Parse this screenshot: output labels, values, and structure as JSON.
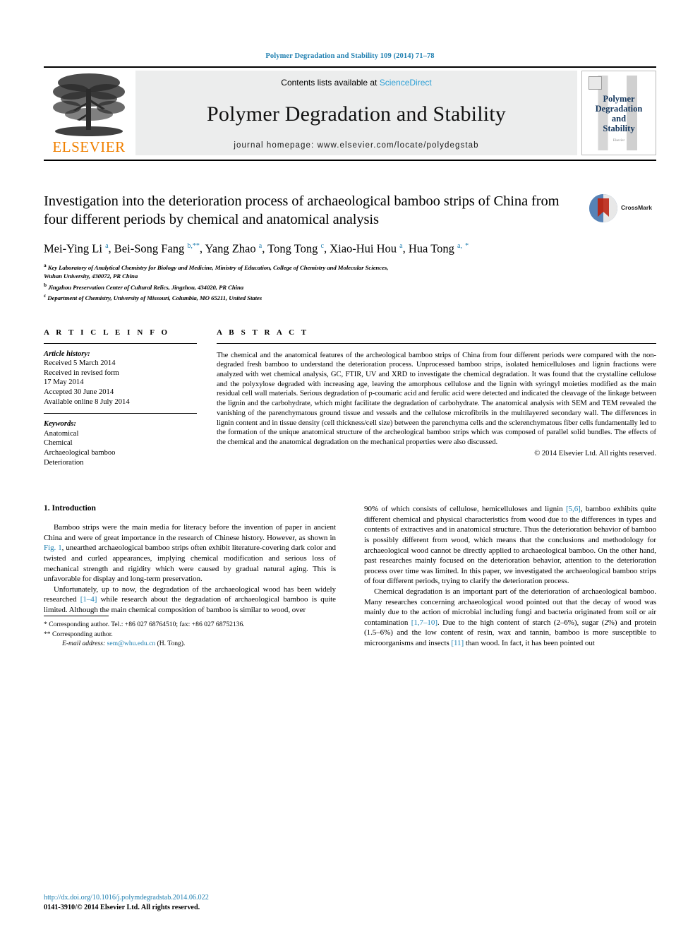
{
  "running_head": "Polymer Degradation and Stability 109 (2014) 71–78",
  "masthead": {
    "publisher": "ELSEVIER",
    "contents_prefix": "Contents lists available at ",
    "contents_link": "ScienceDirect",
    "journal_title": "Polymer Degradation and Stability",
    "homepage": "journal homepage: www.elsevier.com/locate/polydegstab",
    "cover_title_lines": [
      "Polymer",
      "Degradation",
      "and",
      "Stability"
    ],
    "cover_footer": "Elsevier"
  },
  "article": {
    "title": "Investigation into the deterioration process of archaeological bamboo strips of China from four different periods by chemical and anatomical analysis",
    "crossmark_label": "CrossMark",
    "authors_html": "Mei-Ying Li <sup>a</sup>, Bei-Song Fang <sup>b,**</sup>, Yang Zhao <sup>a</sup>, Tong Tong <sup>c</sup>, Xiao-Hui Hou <sup>a</sup>, Hua Tong <sup>a,</sup> <sup>*</sup>",
    "affiliations": [
      "Key Laboratory of Analytical Chemistry for Biology and Medicine, Ministry of Education, College of Chemistry and Molecular Sciences,",
      "Wuhan University, 430072, PR China",
      "Jingzhou Preservation Center of Cultural Relics, Jingzhou, 434020, PR China",
      "Department of Chemistry, University of Missouri, Columbia, MO 65211, United States"
    ],
    "affiliation_marks": [
      "a",
      "",
      "b",
      "c"
    ]
  },
  "article_info": {
    "heading": "A R T I C L E   I N F O",
    "history_label": "Article history:",
    "history": [
      "Received 5 March 2014",
      "Received in revised form",
      "17 May 2014",
      "Accepted 30 June 2014",
      "Available online 8 July 2014"
    ],
    "keywords_label": "Keywords:",
    "keywords": [
      "Anatomical",
      "Chemical",
      "Archaeological bamboo",
      "Deterioration"
    ]
  },
  "abstract": {
    "heading": "A B S T R A C T",
    "text": "The chemical and the anatomical features of the archeological bamboo strips of China from four different periods were compared with the non-degraded fresh bamboo to understand the deterioration process. Unprocessed bamboo strips, isolated hemicelluloses and lignin fractions were analyzed with wet chemical analysis, GC, FTIR, UV and XRD to investigate the chemical degradation. It was found that the crystalline cellulose and the polyxylose degraded with increasing age, leaving the amorphous cellulose and the lignin with syringyl moieties modified as the main residual cell wall materials. Serious degradation of p-coumaric acid and ferulic acid were detected and indicated the cleavage of the linkage between the lignin and the carbohydrate, which might facilitate the degradation of carbohydrate. The anatomical analysis with SEM and TEM revealed the vanishing of the parenchymatous ground tissue and vessels and the cellulose microfibrils in the multilayered secondary wall. The differences in lignin content and in tissue density (cell thickness/cell size) between the parenchyma cells and the sclerenchymatous fiber cells fundamentally led to the formation of the unique anatomical structure of the archeological bamboo strips which was composed of parallel solid bundles. The effects of the chemical and the anatomical degradation on the mechanical properties were also discussed.",
    "copyright": "© 2014 Elsevier Ltd. All rights reserved."
  },
  "introduction": {
    "heading": "1.  Introduction",
    "left_paragraphs": [
      "Bamboo strips were the main media for literacy before the invention of paper in ancient China and were of great importance in the research of Chinese history. However, as shown in @@Fig. 1@@, unearthed archaeological bamboo strips often exhibit literature-covering dark color and twisted and curled appearances, implying chemical modification and serious loss of mechanical strength and rigidity which were caused by gradual natural aging. This is unfavorable for display and long-term preservation.",
      "Unfortunately, up to now, the degradation of the archaeological wood has been widely researched @@[1–4]@@ while research about the degradation of archaeological bamboo is quite limited. Although the main chemical composition of bamboo is similar to wood, over"
    ],
    "right_paragraphs": [
      "90% of which consists of cellulose, hemicelluloses and lignin @@[5,6]@@, bamboo exhibits quite different chemical and physical characteristics from wood due to the differences in types and contents of extractives and in anatomical structure. Thus the deterioration behavior of bamboo is possibly different from wood, which means that the conclusions and methodology for archaeological wood cannot be directly applied to archaeological bamboo. On the other hand, past researches mainly focused on the deterioration behavior, attention to the deterioration process over time was limited. In this paper, we investigated the archaeological bamboo strips of four different periods, trying to clarify the deterioration process.",
      "Chemical degradation is an important part of the deterioration of archaeological bamboo. Many researches concerning archaeological wood pointed out that the decay of wood was mainly due to the action of microbial including fungi and bacteria originated from soil or air contamination @@[1,7–10]@@. Due to the high content of starch (2–6%), sugar (2%) and protein (1.5–6%) and the low content of resin, wax and tannin, bamboo is more susceptible to microorganisms and insects @@[11]@@ than wood. In fact, it has been pointed out"
    ]
  },
  "footnotes": {
    "rule": true,
    "lines": [
      "* Corresponding author. Tel.: +86 027 68764510; fax: +86 027 68752136.",
      "** Corresponding author."
    ],
    "email_label": "E-mail address:",
    "email": "sem@whu.edu.cn",
    "email_suffix": " (H. Tong)."
  },
  "footer": {
    "doi": "http://dx.doi.org/10.1016/j.polymdegradstab.2014.06.022",
    "issn": "0141-3910/© 2014 Elsevier Ltd. All rights reserved."
  },
  "colors": {
    "link_blue": "#1f7fb0",
    "sciencedirect_blue": "#2a9fd6",
    "elsevier_orange": "#f08000",
    "cover_navy": "#14365c",
    "masthead_gray": "#eceded"
  }
}
